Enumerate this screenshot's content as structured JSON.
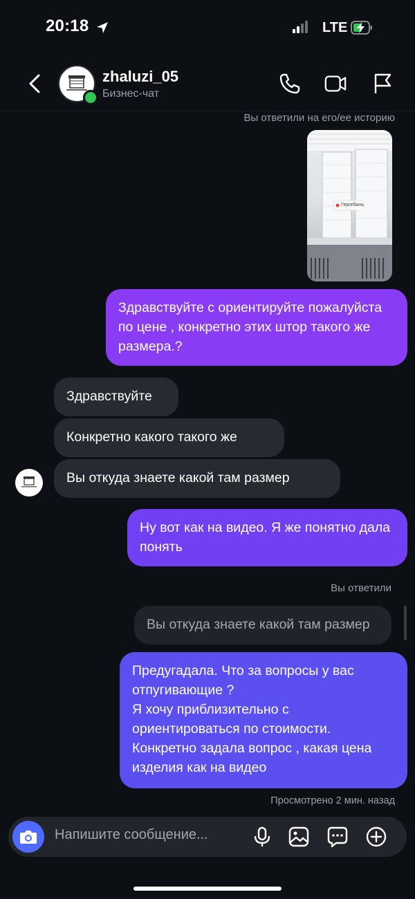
{
  "status_bar": {
    "time": "20:18",
    "network": "LTE",
    "icons": [
      "location-arrow-icon",
      "signal-icon",
      "battery-charging-icon"
    ]
  },
  "header": {
    "contact_name": "zhaluzi_05",
    "contact_subtitle": "Бизнес-чат",
    "icons": [
      "back-chevron-icon",
      "phone-icon",
      "video-camera-icon",
      "flag-icon"
    ]
  },
  "conversation": {
    "story_reply_label": "Вы ответили на его/ее историю",
    "story_preview": {
      "location_tag": "Гергебиль"
    },
    "messages": [
      {
        "side": "out",
        "text": "Здравствуйте с ориентируйте пожалуйста по цене , конкретно этих штор такого же размера.?"
      },
      {
        "side": "in",
        "text": "Здравствуйте"
      },
      {
        "side": "in",
        "text": "Конкретно какого такого же"
      },
      {
        "side": "in",
        "text": "Вы откуда знаете какой там размер"
      },
      {
        "side": "out",
        "text": "Ну вот как на видео. Я же понятно дала понять"
      }
    ],
    "reply_label": "Вы ответили",
    "quoted_text": "Вы откуда знаете какой там размер",
    "last_message": {
      "side": "out",
      "lines": [
        "Предугадала. Что за вопросы у вас отпугивающие ?",
        "Я хочу приблизительно с ориентироваться по стоимости.",
        "Конкретно задала вопрос , какая цена изделия как на видео"
      ]
    },
    "seen_label": "Просмотрено 2 мин. назад"
  },
  "composer": {
    "placeholder": "Напишите сообщение...",
    "icons": [
      "camera-icon",
      "microphone-icon",
      "gallery-icon",
      "sticker-icon",
      "add-icon"
    ]
  },
  "colors": {
    "background": "#0c0f14",
    "incoming_bubble": "#262a31",
    "outgoing_gradient_top": "#8a3cf5",
    "outgoing_gradient_bottom": "#5b4ff0",
    "camera_button": "#4f6bff",
    "online": "#31c553"
  }
}
